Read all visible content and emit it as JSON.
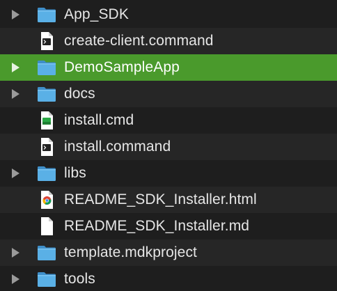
{
  "files": [
    {
      "name": "App_SDK",
      "kind": "folder",
      "icon": "folder-icon",
      "expandable": true,
      "selected": false
    },
    {
      "name": "create-client.command",
      "kind": "terminal",
      "icon": "terminal-file-icon",
      "expandable": false,
      "selected": false
    },
    {
      "name": "DemoSampleApp",
      "kind": "folder",
      "icon": "folder-icon",
      "expandable": true,
      "selected": true
    },
    {
      "name": "docs",
      "kind": "folder",
      "icon": "folder-icon",
      "expandable": true,
      "selected": false
    },
    {
      "name": "install.cmd",
      "kind": "cmd",
      "icon": "cmd-file-icon",
      "expandable": false,
      "selected": false
    },
    {
      "name": "install.command",
      "kind": "terminal",
      "icon": "terminal-file-icon",
      "expandable": false,
      "selected": false
    },
    {
      "name": "libs",
      "kind": "folder",
      "icon": "folder-icon",
      "expandable": true,
      "selected": false
    },
    {
      "name": "README_SDK_Installer.html",
      "kind": "html",
      "icon": "chrome-html-file-icon",
      "expandable": false,
      "selected": false
    },
    {
      "name": "README_SDK_Installer.md",
      "kind": "doc",
      "icon": "blank-document-icon",
      "expandable": false,
      "selected": false
    },
    {
      "name": "template.mdkproject",
      "kind": "folder",
      "icon": "folder-icon",
      "expandable": true,
      "selected": false
    },
    {
      "name": "tools",
      "kind": "folder",
      "icon": "folder-icon",
      "expandable": true,
      "selected": false
    }
  ],
  "colors": {
    "selection": "#4a9a2c",
    "folder": "#5ab0e6",
    "text": "#e6e6e6",
    "row_alt": "#262626",
    "background": "#1e1e1e"
  }
}
